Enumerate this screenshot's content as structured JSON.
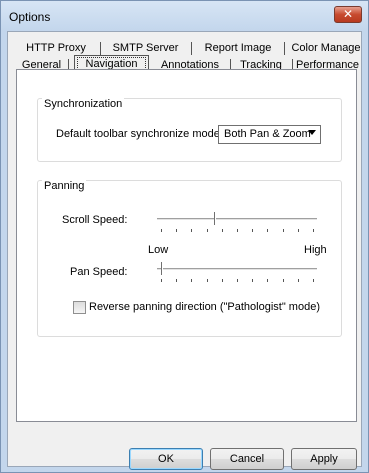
{
  "window": {
    "title": "Options",
    "close_glyph": "✕"
  },
  "tabs_top": [
    "HTTP Proxy",
    "SMTP Server",
    "Report Image",
    "Color Manage"
  ],
  "tabs_bottom": [
    "General",
    "Navigation",
    "Annotations",
    "Tracking",
    "Performance"
  ],
  "active_tab": "Navigation",
  "synchronization": {
    "title": "Synchronization",
    "label": "Default toolbar synchronize mode:",
    "value": "Both Pan & Zoom"
  },
  "panning": {
    "title": "Panning",
    "scroll_speed_label": "Scroll Speed:",
    "scroll_speed_value": 0.35,
    "low_label": "Low",
    "high_label": "High",
    "pan_speed_label": "Pan Speed:",
    "pan_speed_value": 0.0,
    "reverse_label": "Reverse panning direction (\"Pathologist\" mode)",
    "reverse_checked": false
  },
  "buttons": {
    "ok": "OK",
    "cancel": "Cancel",
    "apply": "Apply"
  },
  "colors": {
    "accent": "#3c7fb1",
    "close": "#c74a2f"
  }
}
